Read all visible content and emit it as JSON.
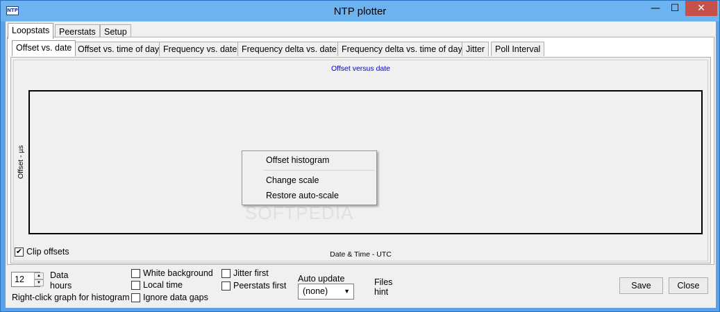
{
  "window": {
    "icon_text": "NTP",
    "title": "NTP plotter",
    "min_glyph": "—",
    "max_glyph": "☐",
    "close_glyph": "✕"
  },
  "top_tabs": [
    "Loopstats",
    "Peerstats",
    "Setup"
  ],
  "sub_tabs": [
    "Offset vs. date",
    "Offset vs. time of day",
    "Frequency vs. date",
    "Frequency delta vs. date",
    "Frequency delta vs. time of day",
    "Jitter",
    "Poll Interval"
  ],
  "chart": {
    "title": "Offset versus date",
    "ylabel": "Offset - µs",
    "xlabel": "Date & Time - UTC"
  },
  "watermark": "SOFTPEDIA",
  "context_menu": {
    "item1": "Offset histogram",
    "item2": "Change scale",
    "item3": "Restore auto-scale"
  },
  "clip_offsets": {
    "label": "Clip offsets",
    "checked": true,
    "glyph": "✔"
  },
  "bottom": {
    "hours_value": "12",
    "spin_up": "▲",
    "spin_down": "▼",
    "data_label": "Data",
    "hours_label": "hours",
    "hint_text": "Right-click graph for histogram",
    "white_background": "White background",
    "local_time": "Local time",
    "ignore_gaps": "Ignore data gaps",
    "jitter_first": "Jitter first",
    "peerstats_first": "Peerstats first",
    "auto_update_label": "Auto update",
    "auto_update_value": "(none)",
    "auto_update_chevron": "▼",
    "files_label": "Files",
    "files_hint": "hint",
    "save": "Save",
    "close": "Close"
  },
  "colors": {
    "title_bar": "#6cb3f0",
    "close_button": "#c7504b",
    "chart_title": "#0000cc"
  }
}
